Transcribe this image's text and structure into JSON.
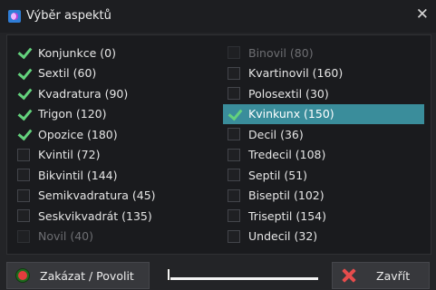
{
  "window": {
    "title": "Výběr aspektů",
    "close_glyph": "✕"
  },
  "aspects_left": [
    {
      "label": "Konjunkce (0)",
      "checked": true,
      "enabled": true,
      "selected": false
    },
    {
      "label": "Sextil (60)",
      "checked": true,
      "enabled": true,
      "selected": false
    },
    {
      "label": "Kvadratura (90)",
      "checked": true,
      "enabled": true,
      "selected": false
    },
    {
      "label": "Trigon (120)",
      "checked": true,
      "enabled": true,
      "selected": false
    },
    {
      "label": "Opozice (180)",
      "checked": true,
      "enabled": true,
      "selected": false
    },
    {
      "label": "Kvintil (72)",
      "checked": false,
      "enabled": true,
      "selected": false
    },
    {
      "label": "Bikvintil (144)",
      "checked": false,
      "enabled": true,
      "selected": false
    },
    {
      "label": "Semikvadratura (45)",
      "checked": false,
      "enabled": true,
      "selected": false
    },
    {
      "label": "Seskvikvadrát (135)",
      "checked": false,
      "enabled": true,
      "selected": false
    },
    {
      "label": "Novil (40)",
      "checked": false,
      "enabled": false,
      "selected": false
    }
  ],
  "aspects_right": [
    {
      "label": "Binovil (80)",
      "checked": false,
      "enabled": false,
      "selected": false
    },
    {
      "label": "Kvartinovil (160)",
      "checked": false,
      "enabled": true,
      "selected": false
    },
    {
      "label": "Polosextil (30)",
      "checked": false,
      "enabled": true,
      "selected": false
    },
    {
      "label": "Kvinkunx (150)",
      "checked": true,
      "enabled": true,
      "selected": true
    },
    {
      "label": "Decil (36)",
      "checked": false,
      "enabled": true,
      "selected": false
    },
    {
      "label": "Tredecil (108)",
      "checked": false,
      "enabled": true,
      "selected": false
    },
    {
      "label": "Septil (51)",
      "checked": false,
      "enabled": true,
      "selected": false
    },
    {
      "label": "Biseptil (102)",
      "checked": false,
      "enabled": true,
      "selected": false
    },
    {
      "label": "Triseptil (154)",
      "checked": false,
      "enabled": true,
      "selected": false
    },
    {
      "label": "Undecil (32)",
      "checked": false,
      "enabled": true,
      "selected": false
    }
  ],
  "footer": {
    "toggle_label": "Zakázat / Povolit",
    "close_label": "Zavřít",
    "slider_level": 0
  },
  "colors": {
    "selection": "#3a8d9b",
    "checkmark": "#64d27d",
    "close_icon": "#e64c4c"
  },
  "icons": {
    "app": "astrology-app-icon",
    "toggle": "red-green-dot-icon",
    "close": "red-x-icon"
  }
}
